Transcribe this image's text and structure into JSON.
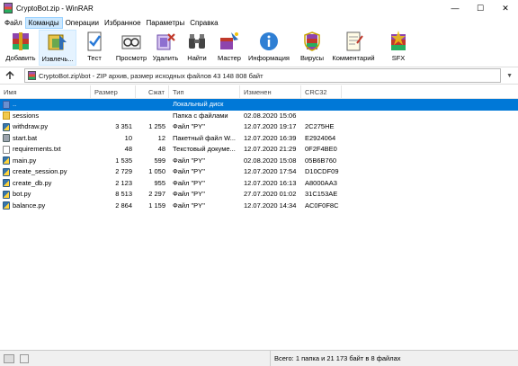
{
  "window": {
    "title": "CryptoBot.zip - WinRAR",
    "controls": {
      "minimize": "—",
      "maximize": "☐",
      "close": "✕"
    }
  },
  "menu": [
    {
      "label": "Файл"
    },
    {
      "label": "Команды"
    },
    {
      "label": "Операции"
    },
    {
      "label": "Избранное"
    },
    {
      "label": "Параметры"
    },
    {
      "label": "Справка"
    }
  ],
  "toolbar": [
    {
      "label": "Добавить",
      "icon": "add-archive-icon"
    },
    {
      "label": "Извлечь...",
      "icon": "extract-icon"
    },
    {
      "label": "Тест",
      "icon": "test-icon"
    },
    {
      "label": "Просмотр",
      "icon": "view-icon"
    },
    {
      "label": "Удалить",
      "icon": "delete-icon"
    },
    {
      "label": "Найти",
      "icon": "find-icon"
    },
    {
      "label": "Мастер",
      "icon": "wizard-icon"
    },
    {
      "label": "Информация",
      "icon": "info-icon"
    },
    {
      "label": "Вирусы",
      "icon": "virus-scan-icon"
    },
    {
      "label": "Комментарий",
      "icon": "comment-icon"
    },
    {
      "label": "SFX",
      "icon": "sfx-icon"
    }
  ],
  "address": {
    "path": "CryptoBot.zip\\bot - ZIP архив, размер исходных файлов 43 148 808 байт"
  },
  "columns": {
    "name": "Имя",
    "size": "Размер",
    "packed": "Сжат",
    "type": "Тип",
    "modified": "Изменен",
    "crc": "CRC32"
  },
  "files": [
    {
      "name": "..",
      "size": "",
      "packed": "",
      "type": "Локальный диск",
      "modified": "",
      "crc": "",
      "kind": "up",
      "selected": true
    },
    {
      "name": "sessions",
      "size": "",
      "packed": "",
      "type": "Папка с файлами",
      "modified": "02.08.2020 15:06",
      "crc": "",
      "kind": "folder"
    },
    {
      "name": "withdraw.py",
      "size": "3 351",
      "packed": "1 255",
      "type": "Файл \"PY\"",
      "modified": "12.07.2020 19:17",
      "crc": "2C275HЕ",
      "kind": "py"
    },
    {
      "name": "start.bat",
      "size": "10",
      "packed": "12",
      "type": "Пакетный файл W...",
      "modified": "12.07.2020 16:39",
      "crc": "E2924064",
      "kind": "bat"
    },
    {
      "name": "requirements.txt",
      "size": "48",
      "packed": "48",
      "type": "Текстовый докуме...",
      "modified": "12.07.2020 21:29",
      "crc": "0F2F4BE0",
      "kind": "txt"
    },
    {
      "name": "main.py",
      "size": "1 535",
      "packed": "599",
      "type": "Файл \"PY\"",
      "modified": "02.08.2020 15:08",
      "crc": "05B6B760",
      "kind": "py"
    },
    {
      "name": "create_session.py",
      "size": "2 729",
      "packed": "1 050",
      "type": "Файл \"PY\"",
      "modified": "12.07.2020 17:54",
      "crc": "D10CDF09",
      "kind": "py"
    },
    {
      "name": "create_db.py",
      "size": "2 123",
      "packed": "955",
      "type": "Файл \"PY\"",
      "modified": "12.07.2020 16:13",
      "crc": "A8000AA3",
      "kind": "py"
    },
    {
      "name": "bot.py",
      "size": "8 513",
      "packed": "2 297",
      "type": "Файл \"PY\"",
      "modified": "27.07.2020 01:02",
      "crc": "31C153AE",
      "kind": "py"
    },
    {
      "name": "balance.py",
      "size": "2 864",
      "packed": "1 159",
      "type": "Файл \"PY\"",
      "modified": "12.07.2020 14:34",
      "crc": "AC0F0F8C",
      "kind": "py"
    }
  ],
  "status": {
    "text": "Всего: 1 папка и 21 173 байт в 8 файлах"
  }
}
